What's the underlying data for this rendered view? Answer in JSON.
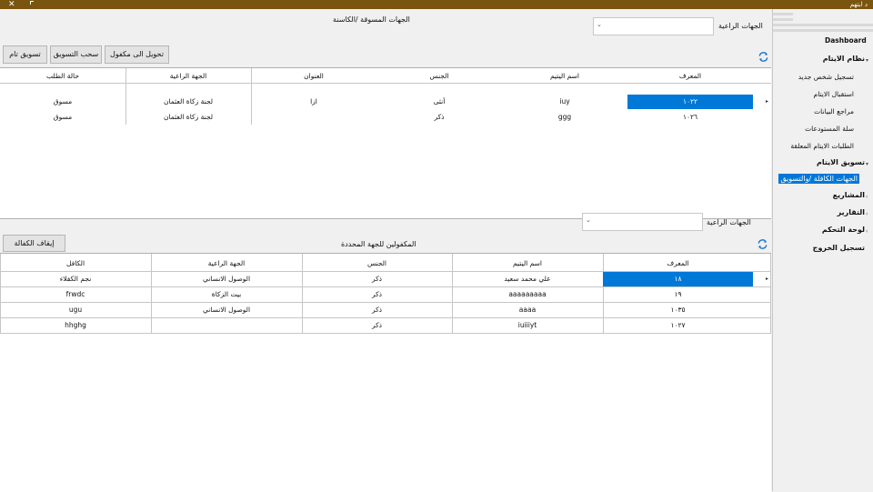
{
  "window": {
    "title": "د ابتهم",
    "close_glyph": "✕"
  },
  "sidebar": {
    "dashboard": "Dashboard",
    "items": [
      {
        "label": "نظام الايتام",
        "kind": "header"
      },
      {
        "label": "تسجيل شخص جديد",
        "kind": "sub"
      },
      {
        "label": "استقبال الايتام",
        "kind": "sub"
      },
      {
        "label": "مراجع البيانات",
        "kind": "sub"
      },
      {
        "label": "سلة المستودعات",
        "kind": "sub"
      },
      {
        "label": "الطلبات الايتام المعلقة",
        "kind": "sub"
      },
      {
        "label": "تسويق الايتام",
        "kind": "header"
      },
      {
        "label": "الجهات الكافلة /والتسويق",
        "kind": "selected"
      },
      {
        "label": "المشاريع",
        "kind": "header"
      },
      {
        "label": "التقارير",
        "kind": "header"
      },
      {
        "label": "لوحة التحكم",
        "kind": "header"
      },
      {
        "label": "تسجيل الخروج",
        "kind": "header"
      }
    ]
  },
  "top": {
    "title": "الجهات المسوقة /الكاسنة",
    "sponsor_label": "الجهات الراعية",
    "combo_value": "",
    "buttons": {
      "transfer": "تحويل الى مكفول",
      "withdraw": "سحب التسويق",
      "market": "تسويق تام"
    },
    "columns": [
      "المعرف",
      "اسم اليتيم",
      "الجنس",
      "العنوان",
      "الجهة الراعية",
      "حالة الطلب"
    ],
    "rows": [
      [
        "١٠٢٢",
        "iuy",
        "أنثى",
        "ازا",
        "لجنة زكاة العثمان",
        "مسوق"
      ],
      [
        "١٠٢٦",
        "ggg",
        "ذكر",
        "",
        "لجنة زكاة العثمان",
        "مسوق"
      ]
    ]
  },
  "bottom": {
    "sponsor_label": "الجهات الراعية",
    "combo_value": "",
    "title": "المكفولين للجهة المحددة",
    "buttons": {
      "stop": "إيقاف الكفالة"
    },
    "columns": [
      "المعرف",
      "اسم اليتيم",
      "الجنس",
      "الجهة الراعية",
      "الكافل"
    ],
    "rows": [
      [
        "١٨",
        "علي محمد سعيد",
        "ذكر",
        "الوصول الانساني",
        "نجم الكفلاء"
      ],
      [
        "١٩",
        "aaaaaaaaa",
        "ذكر",
        "بيت الزكاة",
        "frwdc"
      ],
      [
        "١٠٣٥",
        "aaaa",
        "ذكر",
        "الوصول الانساني",
        "ugu"
      ],
      [
        "١٠٢٧",
        "iuiiiyt",
        "ذكر",
        "",
        "hhghg"
      ]
    ]
  },
  "colors": {
    "titlebar": "#7a5510",
    "selection": "#0078d7",
    "refresh": "#1a73c9"
  },
  "icons": {
    "refresh": "refresh-icon",
    "dropdown": "chevron-down-icon",
    "close": "close-icon",
    "row_pointer": "triangle-right-icon"
  }
}
